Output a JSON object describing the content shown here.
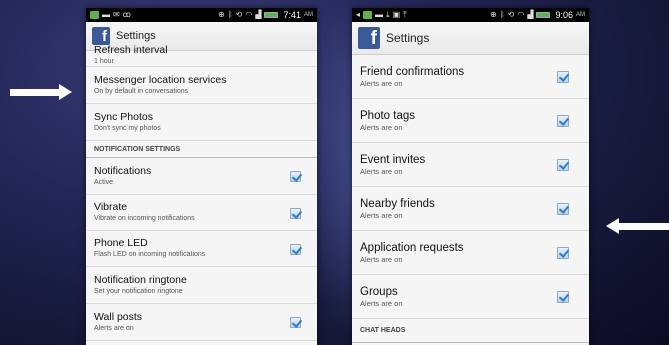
{
  "left_phone": {
    "status_bar": {
      "time": "7:41",
      "ampm": "AM"
    },
    "app_bar": {
      "title": "Settings"
    },
    "rows": [
      {
        "title": "Refresh interval",
        "subtitle": "1 hour"
      },
      {
        "title": "Messenger location services",
        "subtitle": "On by default in conversations"
      },
      {
        "title": "Sync Photos",
        "subtitle": "Don't sync my photos"
      }
    ],
    "section_header": "NOTIFICATION SETTINGS",
    "notification_rows": [
      {
        "title": "Notifications",
        "subtitle": "Active",
        "checked": true
      },
      {
        "title": "Vibrate",
        "subtitle": "Vibrate on incoming notifications",
        "checked": true
      },
      {
        "title": "Phone LED",
        "subtitle": "Flash LED on incoming notifications",
        "checked": true
      },
      {
        "title": "Notification ringtone",
        "subtitle": "Set your notification ringtone",
        "checked": false
      },
      {
        "title": "Wall posts",
        "subtitle": "Alerts are on",
        "checked": true
      }
    ]
  },
  "right_phone": {
    "status_bar": {
      "time": "9:06",
      "ampm": "AM"
    },
    "app_bar": {
      "title": "Settings"
    },
    "rows": [
      {
        "title": "Friend confirmations",
        "subtitle": "Alerts are on",
        "checked": true
      },
      {
        "title": "Photo tags",
        "subtitle": "Alerts are on",
        "checked": true
      },
      {
        "title": "Event invites",
        "subtitle": "Alerts are on",
        "checked": true
      },
      {
        "title": "Nearby friends",
        "subtitle": "Alerts are on",
        "checked": true
      },
      {
        "title": "Application requests",
        "subtitle": "Alerts are on",
        "checked": true
      },
      {
        "title": "Groups",
        "subtitle": "Alerts are on",
        "checked": true
      }
    ],
    "section_header": "CHAT HEADS"
  },
  "fb_logo_letter": "f",
  "colors": {
    "facebook_blue": "#3b5998",
    "checkbox_check": "#2c7bd0",
    "background": "#1c1f48"
  },
  "icons": [
    "arrow-right-icon",
    "arrow-left-icon",
    "facebook-logo-icon",
    "checkbox-checked-icon",
    "battery-icon",
    "wifi-icon",
    "signal-icon",
    "bluetooth-icon"
  ]
}
